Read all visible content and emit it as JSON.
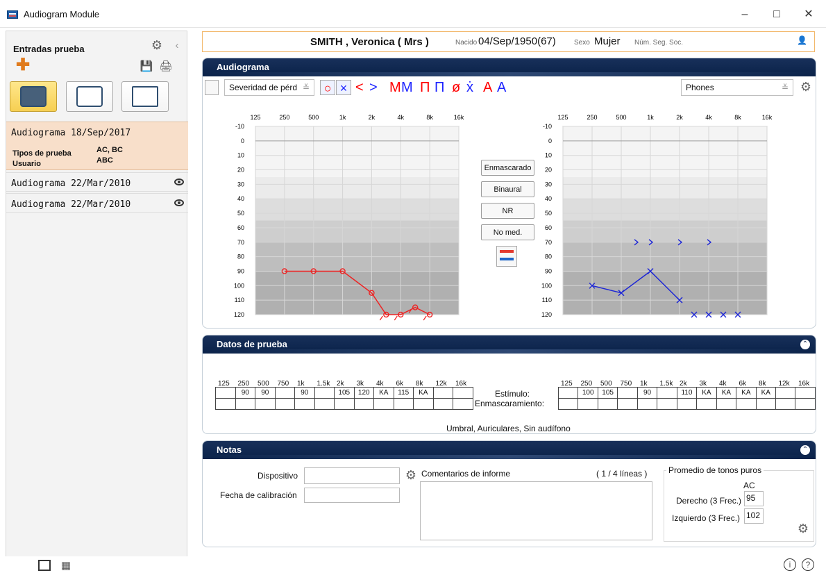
{
  "window": {
    "title": "Audiogram Module",
    "controls": [
      "–",
      "□",
      "✕"
    ]
  },
  "sidebar": {
    "header": "Entradas prueba",
    "records": [
      {
        "name": "Audiograma",
        "date": "18/Sep/2017",
        "details": {
          "types_label": "Tipos de prueba",
          "types_value": "AC, BC",
          "user_label": "Usuario",
          "user_value": "ABC"
        }
      },
      {
        "name": "Audiograma",
        "date": "22/Mar/2010"
      },
      {
        "name": "Audiograma",
        "date": "22/Mar/2010"
      }
    ]
  },
  "patient": {
    "name": "SMITH , Veronica ( Mrs )",
    "born_label": "Nacido",
    "born_value": "04/Sep/1950(67)",
    "sex_label": "Sexo",
    "sex_value": "Mujer",
    "ss_label": "Núm. Seg. Soc."
  },
  "audiogram": {
    "title": "Audiograma",
    "severity_select": "Severidad de pérd",
    "output_select": "Phones",
    "symbol_buttons": [
      "○",
      "×",
      "<",
      ">",
      "M",
      "M",
      "Π",
      "Π",
      "ø",
      "ẋ",
      "A",
      "A"
    ],
    "actions": [
      "Enmascarado",
      "Binaural",
      "NR",
      "No med."
    ],
    "chart_data": [
      {
        "type": "line",
        "ear": "right",
        "x": [
          "125",
          "250",
          "500",
          "1k",
          "2k",
          "4k",
          "8k",
          "16k"
        ],
        "y_ticks": [
          "-10",
          "0",
          "10",
          "20",
          "30",
          "40",
          "50",
          "60",
          "70",
          "80",
          "90",
          "100",
          "110",
          "120"
        ],
        "ylim": [
          -10,
          120
        ],
        "series": [
          {
            "points": [
              {
                "x": "250",
                "y": 90
              },
              {
                "x": "500",
                "y": 90
              },
              {
                "x": "1k",
                "y": 90
              },
              {
                "x": "2k",
                "y": 105
              },
              {
                "x": "3k",
                "y": 120
              },
              {
                "x": "4k",
                "y": 120
              },
              {
                "x": "6k",
                "y": 115
              },
              {
                "x": "8k",
                "y": 120
              }
            ]
          }
        ]
      },
      {
        "type": "line",
        "ear": "left",
        "x": [
          "125",
          "250",
          "500",
          "1k",
          "2k",
          "4k",
          "8k",
          "16k"
        ],
        "y_ticks": [
          "-10",
          "0",
          "10",
          "20",
          "30",
          "40",
          "50",
          "60",
          "70",
          "80",
          "90",
          "100",
          "110",
          "120"
        ],
        "ylim": [
          -10,
          120
        ],
        "series": [
          {
            "points": [
              {
                "x": "250",
                "y": 100
              },
              {
                "x": "500",
                "y": 105
              },
              {
                "x": "1k",
                "y": 90
              },
              {
                "x": "2k",
                "y": 110
              }
            ]
          },
          {
            "points": [
              {
                "x": "750",
                "y": 70
              },
              {
                "x": "1k",
                "y": 70
              },
              {
                "x": "2k",
                "y": 70
              },
              {
                "x": "4k",
                "y": 70
              }
            ]
          },
          {
            "points": [
              {
                "x": "3k",
                "y": 120
              },
              {
                "x": "4k",
                "y": 120
              },
              {
                "x": "6k",
                "y": 120
              },
              {
                "x": "8k",
                "y": 120
              }
            ]
          }
        ]
      }
    ]
  },
  "test_data": {
    "title": "Datos de prueba",
    "frequencies": [
      "125",
      "250",
      "500",
      "750",
      "1k",
      "1.5k",
      "2k",
      "3k",
      "4k",
      "6k",
      "8k",
      "12k",
      "16k"
    ],
    "right_values": [
      "",
      "90",
      "90",
      "",
      "90",
      "",
      "105",
      "120",
      "KA",
      "115",
      "KA",
      "",
      ""
    ],
    "left_values": [
      "",
      "100",
      "105",
      "",
      "90",
      "",
      "110",
      "KA",
      "KA",
      "KA",
      "KA",
      "",
      ""
    ],
    "stimulus_label": "Estímulo:",
    "masking_label": "Enmascaramiento:",
    "caption": "Umbral, Auriculares, Sin audífono"
  },
  "notes": {
    "title": "Notas",
    "device_label": "Dispositivo",
    "calibration_label": "Fecha de calibración",
    "comments_label": "Comentarios de informe",
    "comments_count": "( 1 / 4 líneas )",
    "pure_tone_title": "Promedio de tonos puros",
    "ac_label": "AC",
    "right_avg_label": "Derecho (3 Frec.)",
    "right_avg_value": "95",
    "left_avg_label": "Izquierdo (3 Frec.)",
    "left_avg_value": "102"
  },
  "icons": {
    "settings": "settings-icon",
    "collapse": "collapse-icon",
    "add": "add-icon",
    "save": "save-icon",
    "print": "print-icon",
    "view": "eye-icon",
    "user": "user-icon",
    "help": "help-icon",
    "info": "info-icon"
  }
}
